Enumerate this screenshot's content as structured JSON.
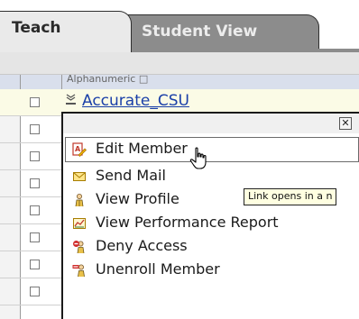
{
  "tabs": [
    {
      "label": "Teach",
      "active": true
    },
    {
      "label": "Student View",
      "active": false
    }
  ],
  "grid": {
    "column_header": "Alphanumeric □",
    "first_member": "Accurate_CSU"
  },
  "menu": {
    "close_label": "✕",
    "items": [
      {
        "label": "Edit Member",
        "icon": "edit-member-icon"
      },
      {
        "label": "Send Mail",
        "icon": "mail-icon"
      },
      {
        "label": "View Profile",
        "icon": "profile-icon"
      },
      {
        "label": "View Performance Report",
        "icon": "performance-report-icon"
      },
      {
        "label": "Deny Access",
        "icon": "deny-access-icon"
      },
      {
        "label": "Unenroll Member",
        "icon": "unenroll-icon"
      }
    ]
  },
  "tooltip": {
    "text": "Link opens in a n"
  },
  "colors": {
    "tab_active_bg": "#eaeaea",
    "tab_inactive_bg": "#8c8c8c",
    "link": "#1a3fa8",
    "header_row_bg": "#d9dfec",
    "tooltip_bg": "#ffffe1"
  }
}
